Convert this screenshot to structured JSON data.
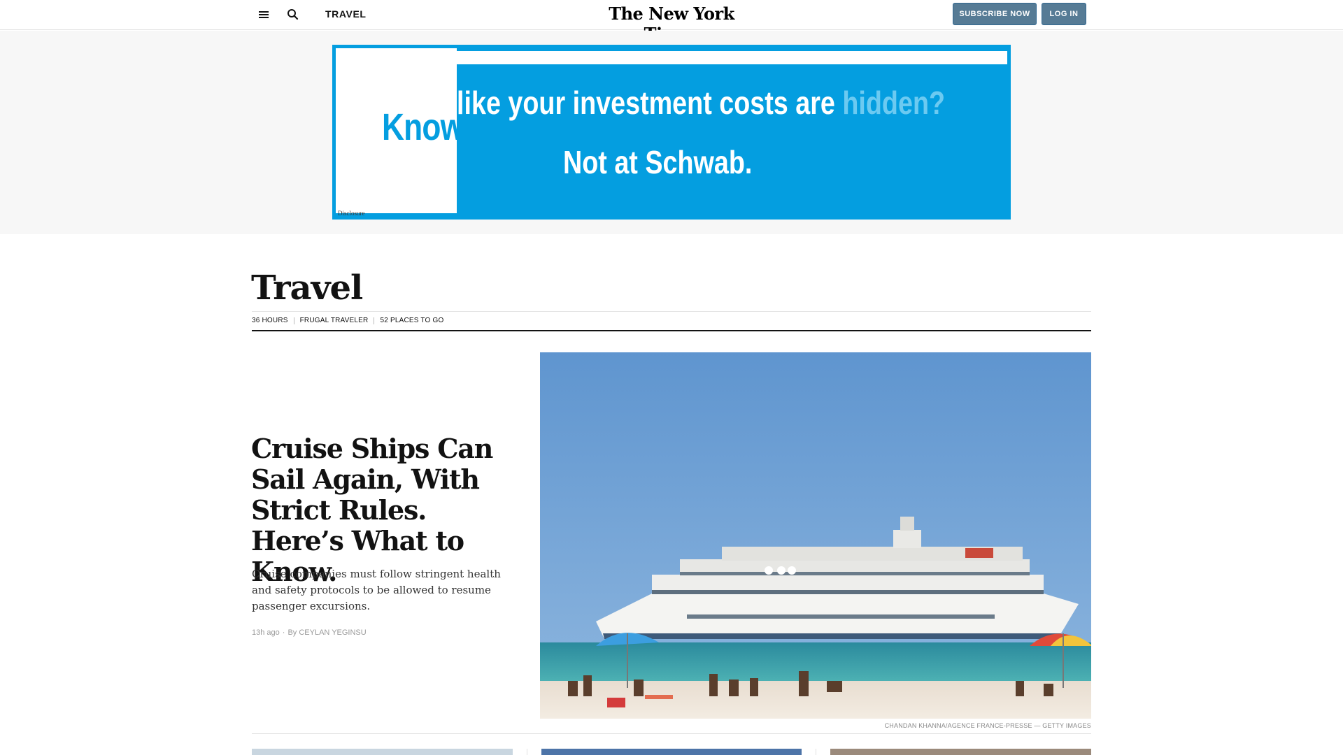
{
  "topbar": {
    "section_label": "TRAVEL",
    "masthead": "The New York Times",
    "subscribe_label": "SUBSCRIBE NOW",
    "login_label": "LOG IN",
    "menu_icon": "hamburger-menu-icon",
    "search_icon": "search-icon"
  },
  "ad": {
    "know_text": "Know",
    "line1_main": "like your investment costs are",
    "line1_highlight": "hidden?",
    "line2": "Not at Schwab.",
    "disclosure": "Disclosure",
    "accent_color": "#049ee0"
  },
  "section": {
    "title": "Travel",
    "subnav": [
      "36 HOURS",
      "FRUGAL TRAVELER",
      "52 PLACES TO GO"
    ]
  },
  "lead_story": {
    "headline": "Cruise Ships Can Sail Again, With Strict Rules. Here’s What to Know.",
    "summary": "Cruise companies must follow stringent health and safety protocols to be allowed to resume passenger excursions.",
    "time": "13h ago",
    "byline": "By CEYLAN YEGINSU",
    "photo_credit": "CHANDAN KHANNA/AGENCE FRANCE-PRESSE — GETTY IMAGES"
  }
}
